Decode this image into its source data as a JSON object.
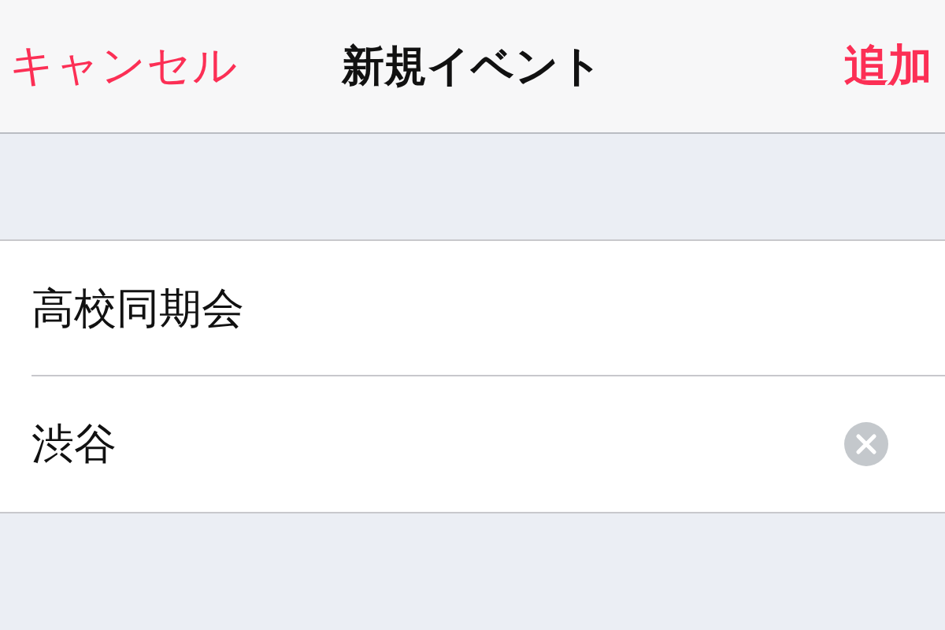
{
  "nav": {
    "cancel": "キャンセル",
    "title": "新規イベント",
    "add": "追加"
  },
  "fields": [
    {
      "value": "高校同期会",
      "clear_button": false
    },
    {
      "value": "渋谷",
      "clear_button": true
    }
  ]
}
